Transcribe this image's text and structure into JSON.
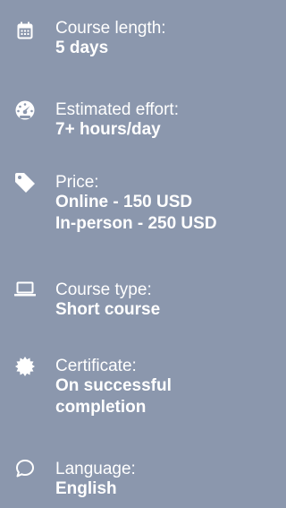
{
  "course_details": {
    "items": [
      {
        "icon": "calendar-icon",
        "label": "Course length:",
        "value_lines": [
          "5 days"
        ]
      },
      {
        "icon": "speedometer-icon",
        "label": "Estimated effort:",
        "value_lines": [
          "7+ hours/day"
        ]
      },
      {
        "icon": "price-tag-icon",
        "label": "Price:",
        "value_lines": [
          "Online - 150 USD",
          "In-person - 250 USD"
        ]
      },
      {
        "icon": "laptop-icon",
        "label": "Course type:",
        "value_lines": [
          "Short course"
        ]
      },
      {
        "icon": "certificate-badge-icon",
        "label": "Certificate:",
        "value_lines": [
          "On successful",
          "completion"
        ]
      },
      {
        "icon": "speech-bubble-icon",
        "label": "Language:",
        "value_lines": [
          "English"
        ]
      }
    ]
  },
  "colors": {
    "background": "#8b97ad",
    "text": "#ffffff"
  }
}
